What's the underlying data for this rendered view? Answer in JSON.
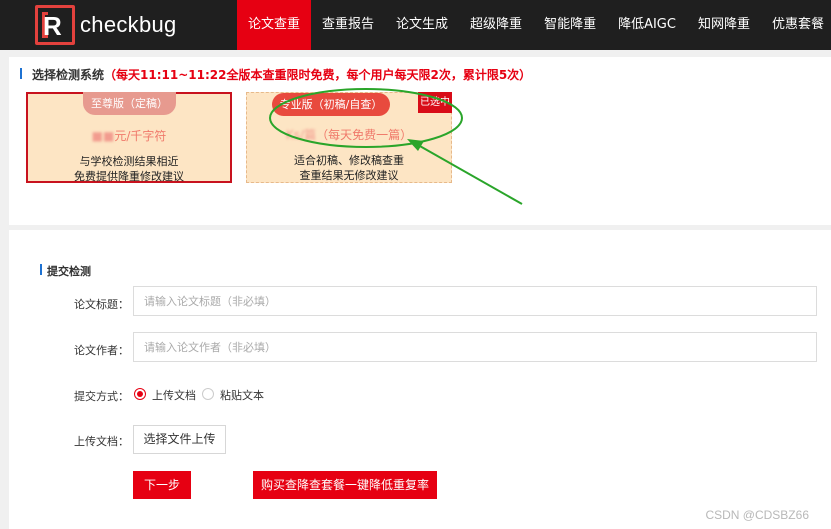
{
  "brand": {
    "name": "checkbug",
    "mark": "R"
  },
  "nav": {
    "items": [
      {
        "label": "论文查重",
        "active": true
      },
      {
        "label": "查重报告",
        "active": false
      },
      {
        "label": "论文生成",
        "active": false
      },
      {
        "label": "超级降重",
        "active": false
      },
      {
        "label": "智能降重",
        "active": false
      },
      {
        "label": "降低AIGC",
        "active": false
      },
      {
        "label": "知网降重",
        "active": false
      },
      {
        "label": "优惠套餐",
        "active": false
      }
    ]
  },
  "system_section": {
    "title": "选择检测系统",
    "promo": "（每天11:11~11:22全版本查重限时免费，每个用户每天限2次，累计限5次）",
    "cards": [
      {
        "tab": "至尊版（定稿）",
        "price": "■■元/千字符",
        "desc1": "与学校检测结果相近",
        "desc2": "免费提供降重修改建议"
      },
      {
        "tab": "专业版（初稿/自查）",
        "price_blur": "Ks/篇",
        "price": "（每天免费一篇）",
        "desc1": "适合初稿、修改稿查重",
        "desc2": "查重结果无修改建议",
        "selected_tag": "已选中"
      }
    ]
  },
  "submit_section": {
    "title": "提交检测",
    "title_label": "论文标题：",
    "title_placeholder": "请输入论文标题（非必填）",
    "author_label": "论文作者：",
    "author_placeholder": "请输入论文作者（非必填）",
    "method_label": "提交方式：",
    "method_options": [
      "上传文档",
      "粘贴文本"
    ],
    "method_selected": "上传文档",
    "upload_label": "上传文档：",
    "upload_button": "选择文件上传",
    "next_button": "下一步",
    "buy_button": "购买查降查套餐一键降低重复率"
  },
  "watermark": "CSDN @CDSBZ66",
  "colors": {
    "accent": "#e60012",
    "nav_bg": "#1f1f1f",
    "card_bg": "#fde5c4",
    "annotation": "#2aa52a"
  }
}
